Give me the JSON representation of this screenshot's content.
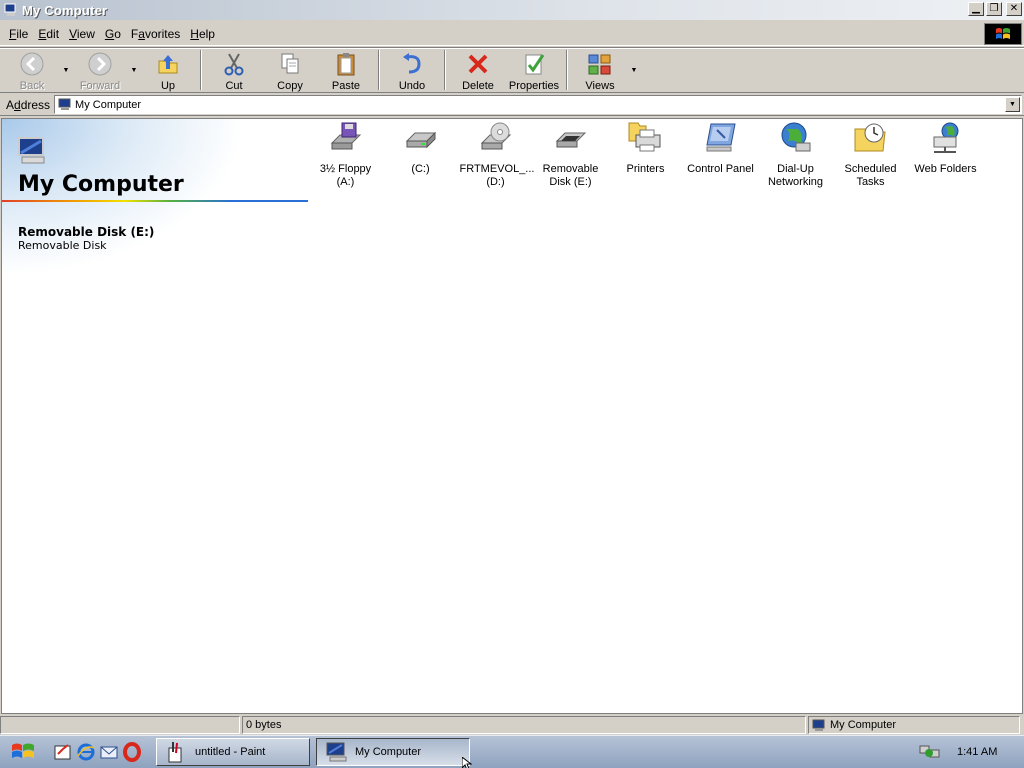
{
  "window": {
    "title": "My Computer",
    "buttons": {
      "minimize": "▁",
      "maximize": "❐",
      "close": "✕"
    }
  },
  "menu": [
    {
      "label": "File",
      "key": "F",
      "rest": "ile"
    },
    {
      "label": "Edit",
      "key": "E",
      "rest": "dit"
    },
    {
      "label": "View",
      "key": "V",
      "rest": "iew"
    },
    {
      "label": "Go",
      "key": "G",
      "rest": "o"
    },
    {
      "label": "Favorites",
      "key": "a",
      "pre": "F",
      "rest": "vorites"
    },
    {
      "label": "Help",
      "key": "H",
      "rest": "elp"
    }
  ],
  "toolbar": {
    "back": "Back",
    "forward": "Forward",
    "up": "Up",
    "cut": "Cut",
    "copy": "Copy",
    "paste": "Paste",
    "undo": "Undo",
    "delete": "Delete",
    "properties": "Properties",
    "views": "Views",
    "dropdown_arrow": "▼"
  },
  "address": {
    "label_pre": "A",
    "label_key": "d",
    "label_rest": "dress",
    "value": "My Computer",
    "dropdown_arrow": "▼"
  },
  "left_pane": {
    "title": "My Computer",
    "selected_name": "Removable Disk (E:)",
    "selected_type": "Removable Disk"
  },
  "items": [
    {
      "name": "3½ Floppy (A:)",
      "line1": "3½ Floppy",
      "line2": "(A:)",
      "icon": "floppy-drive-icon"
    },
    {
      "name": "(C:)",
      "line1": "(C:)",
      "line2": "",
      "icon": "hard-drive-icon"
    },
    {
      "name": "FRTMEVOL_... (D:)",
      "line1": "FRTMEVOL_...",
      "line2": "(D:)",
      "icon": "cd-drive-icon"
    },
    {
      "name": "Removable Disk (E:)",
      "line1": "Removable",
      "line2": "Disk (E:)",
      "icon": "removable-disk-icon"
    },
    {
      "name": "Printers",
      "line1": "Printers",
      "line2": "",
      "icon": "printers-folder-icon"
    },
    {
      "name": "Control Panel",
      "line1": "Control Panel",
      "line2": "",
      "icon": "control-panel-icon"
    },
    {
      "name": "Dial-Up Networking",
      "line1": "Dial-Up",
      "line2": "Networking",
      "icon": "dialup-networking-icon"
    },
    {
      "name": "Scheduled Tasks",
      "line1": "Scheduled",
      "line2": "Tasks",
      "icon": "scheduled-tasks-icon"
    },
    {
      "name": "Web Folders",
      "line1": "Web Folders",
      "line2": "",
      "icon": "web-folders-icon"
    }
  ],
  "status": {
    "size": "0 bytes",
    "location": "My Computer"
  },
  "taskbar": {
    "tasks": [
      {
        "label": "untitled - Paint",
        "active": false
      },
      {
        "label": "My Computer",
        "active": true
      }
    ],
    "clock": "1:41 AM"
  },
  "colors": {
    "accent_blue": "#2a6fd6",
    "content_bg": "#ffffff",
    "chrome": "#d4d0c8"
  }
}
